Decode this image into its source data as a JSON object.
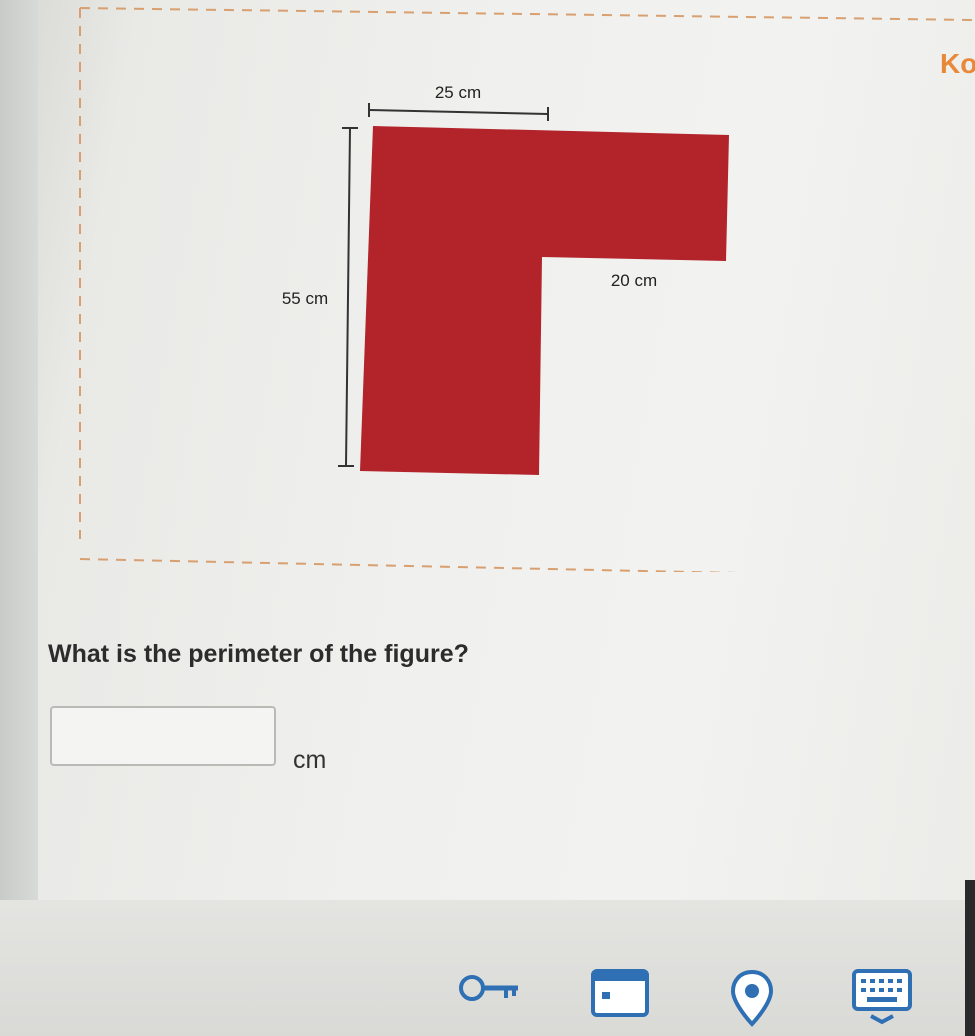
{
  "header": {
    "brand_partial": "Ko"
  },
  "figure": {
    "top_label": "25 cm",
    "left_label": "55 cm",
    "inner_label": "20 cm",
    "shape_color": "#b3232a"
  },
  "question": {
    "text": "What is the perimeter of the figure?",
    "answer_value": "",
    "unit": "cm"
  },
  "toolbar": {
    "icons": [
      "key-icon",
      "card-icon",
      "location-pin-icon",
      "keyboard-icon"
    ]
  }
}
